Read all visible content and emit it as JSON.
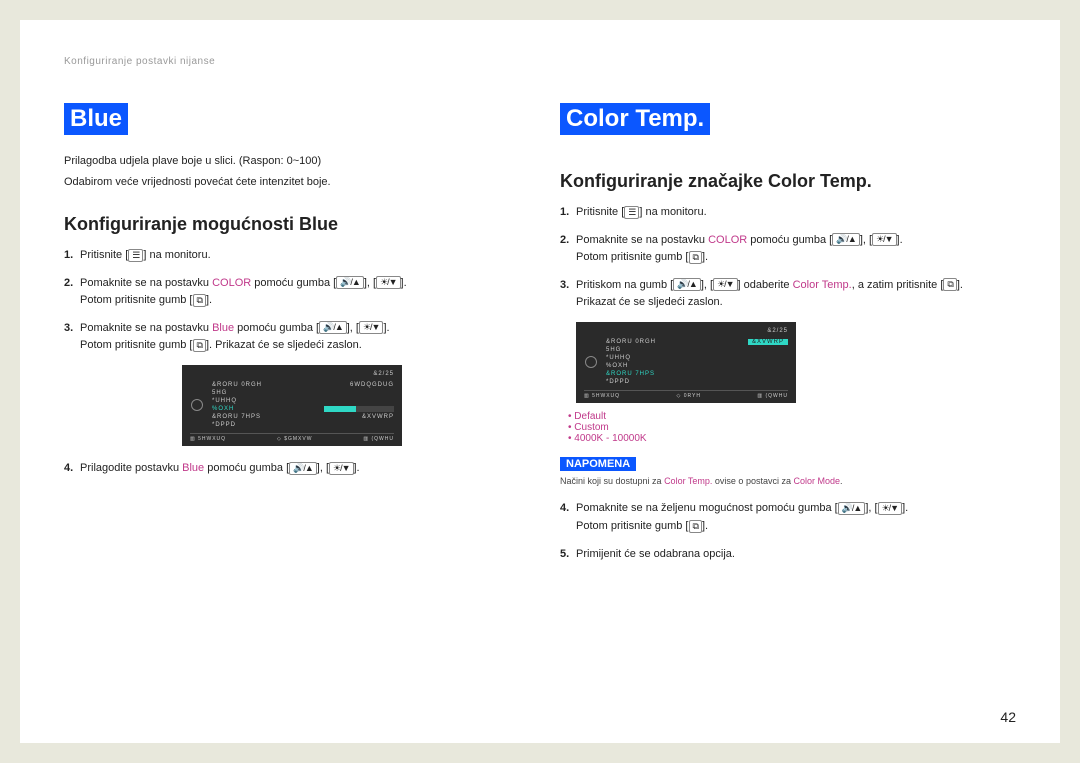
{
  "breadcrumb": "Konfiguriranje postavki nijanse",
  "page_number": "42",
  "left": {
    "heading": "Blue",
    "intro1": "Prilagodba udjela plave boje u slici. (Raspon: 0~100)",
    "intro2": "Odabirom veće vrijednosti povećat ćete intenzitet boje.",
    "sub": "Konfiguriranje mogućnosti Blue",
    "s1a": "Pritisnite [",
    "s1b": "] na monitoru.",
    "s2a": "Pomaknite se na postavku ",
    "s2kw": "COLOR",
    "s2b": " pomoću gumba [",
    "s2c": "], [",
    "s2d": "].",
    "s2e": "Potom pritisnite gumb [",
    "s2f": "].",
    "s3a": "Pomaknite se na postavku ",
    "s3kw": "Blue",
    "s3b": " pomoću gumba [",
    "s3c": "], [",
    "s3d": "].",
    "s3e": "Potom pritisnite gumb [",
    "s3f": "]. Prikazat će se sljedeći zaslon.",
    "s4a": "Prilagodite postavku ",
    "s4kw": "Blue",
    "s4b": " pomoću gumba [",
    "s4c": "], [",
    "s4d": "]."
  },
  "right": {
    "heading": "Color Temp.",
    "sub": "Konfiguriranje značajke Color Temp.",
    "s1a": "Pritisnite [",
    "s1b": "] na monitoru.",
    "s2a": "Pomaknite se na postavku ",
    "s2kw": "COLOR",
    "s2b": " pomoću gumba [",
    "s2c": "], [",
    "s2d": "].",
    "s2e": "Potom pritisnite gumb [",
    "s2f": "].",
    "s3a": "Pritiskom na gumb [",
    "s3b": "], [",
    "s3c": "] odaberite ",
    "s3kw": "Color Temp.",
    "s3d": ", a zatim pritisnite [",
    "s3e": "].",
    "s3f": "Prikazat će se sljedeći zaslon.",
    "bullets": [
      "Default",
      "Custom",
      "4000K - 10000K"
    ],
    "note_hdr": "NAPOMENA",
    "note_a": "Načini koji su dostupni za ",
    "note_kw1": "Color Temp.",
    "note_b": " ovise o postavci za ",
    "note_kw2": "Color Mode",
    "note_c": ".",
    "s4a": "Pomaknite se na željenu mogućnost pomoću gumba [",
    "s4b": "], [",
    "s4c": "].",
    "s4d": "Potom pritisnite gumb [",
    "s4e": "].",
    "s5": "Primijenit će se odabrana opcija."
  },
  "glyph": {
    "menu": "☰",
    "vol_up": "🔊/▲",
    "bright_down": "☀/▼",
    "enter": "⧉"
  },
  "osd1": {
    "title": "&2/25",
    "rows": [
      {
        "l": "&RORU 0RGH",
        "r": "6WDQGDUG"
      },
      {
        "l": "5HG",
        "r": ""
      },
      {
        "l": "*UHHQ",
        "r": ""
      },
      {
        "l": "%OXH",
        "r": "",
        "active": true,
        "bar": true
      },
      {
        "l": "&RORU 7HPS",
        "r": "&XVWRP"
      },
      {
        "l": "*DPPD",
        "r": ""
      }
    ],
    "footer": [
      "▥ 5HWXUQ",
      "◇ $GMXVW",
      "▥ (QWHU"
    ]
  },
  "osd2": {
    "title": "&2/25",
    "rows": [
      {
        "l": "&RORU 0RGH",
        "r": "&XVWRP",
        "rbox": true
      },
      {
        "l": "5HG",
        "r": ""
      },
      {
        "l": "*UHHQ",
        "r": ""
      },
      {
        "l": "%OXH",
        "r": ""
      },
      {
        "l": "&RORU 7HPS",
        "r": "",
        "active": true
      },
      {
        "l": "*DPPD",
        "r": ""
      }
    ],
    "footer": [
      "▥ 5HWXUQ",
      "◇ 0RYH",
      "▥ (QWHU"
    ]
  }
}
